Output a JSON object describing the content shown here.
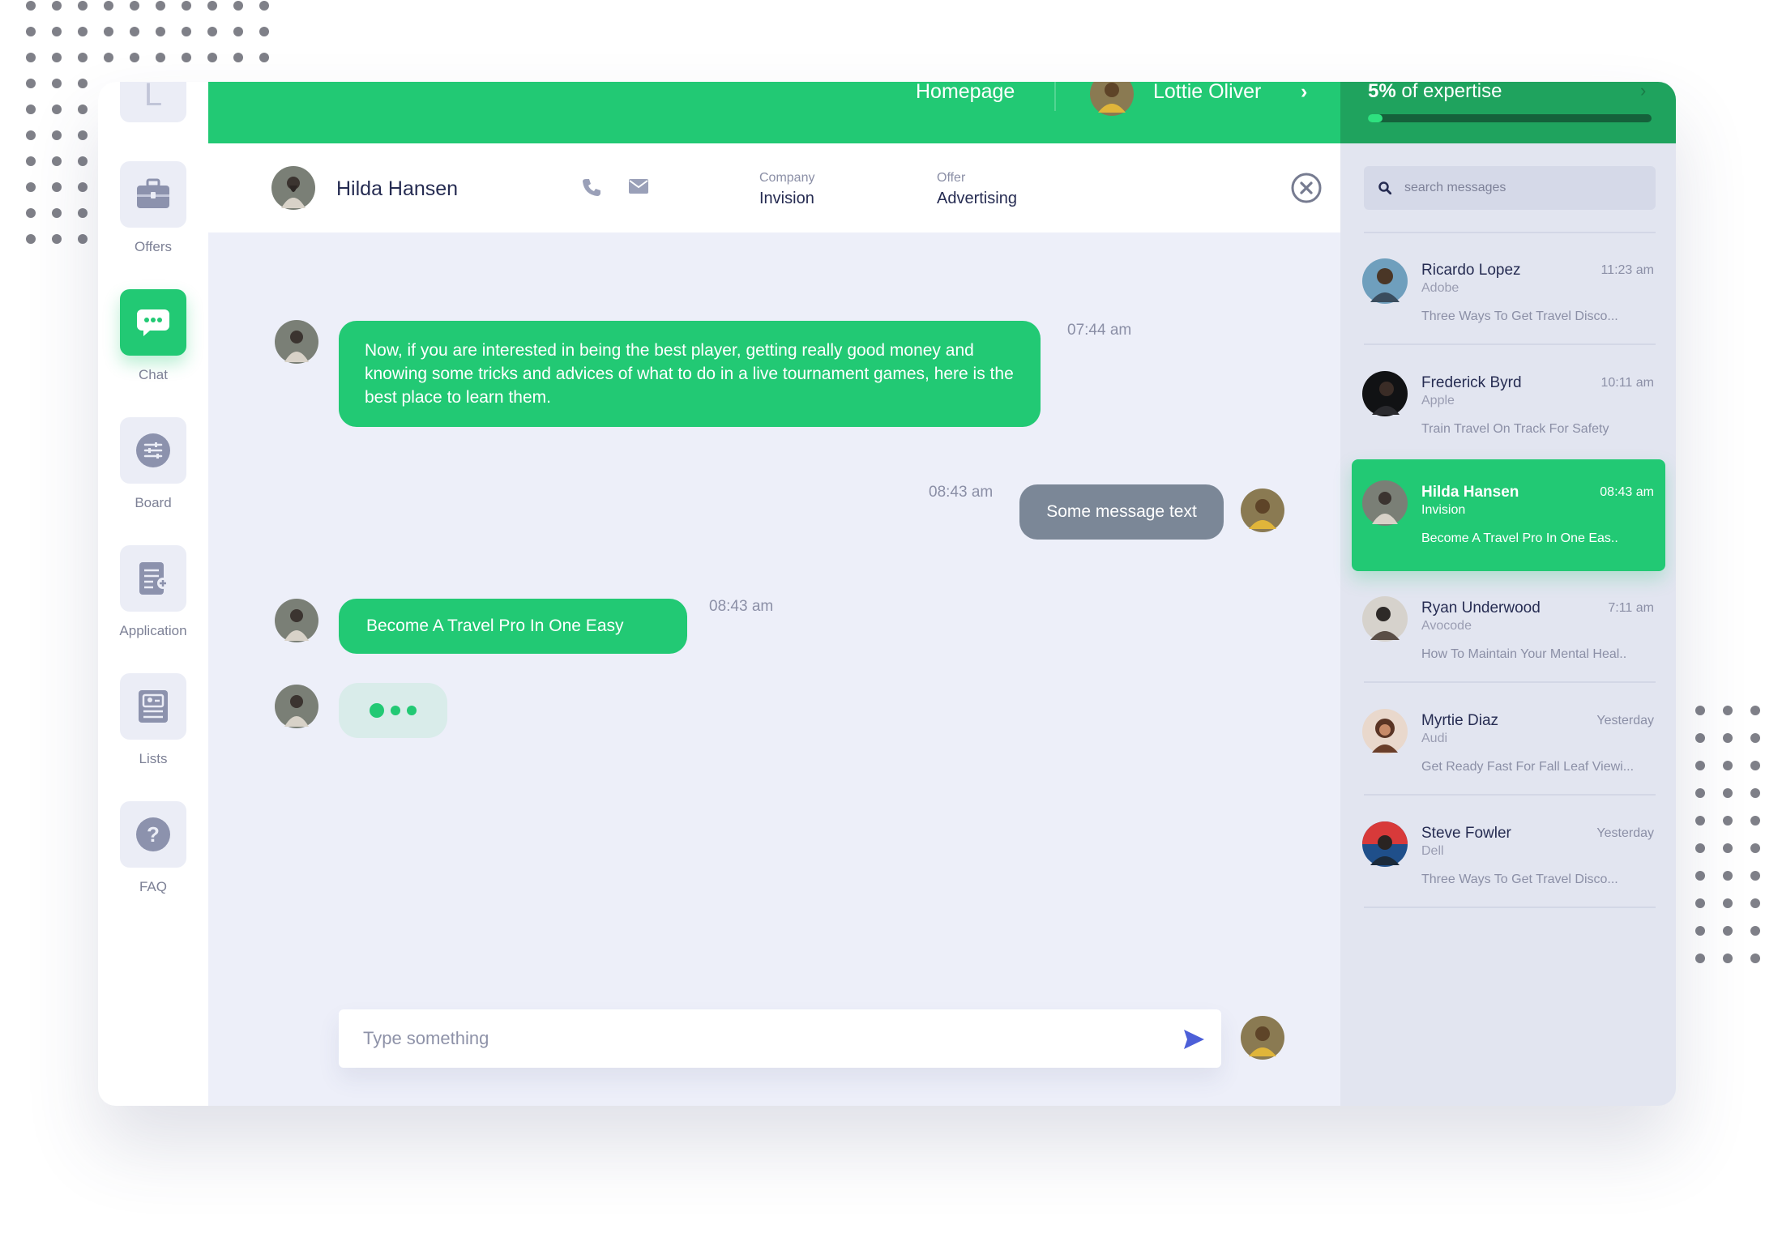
{
  "colors": {
    "accent": "#22c974",
    "accent_dark": "#1fa35e",
    "outgoing": "#7b8797",
    "ink": "#262c52",
    "muted": "#8b8fa6",
    "send": "#4c5fd8"
  },
  "nav": {
    "logo_letter": "L",
    "items": [
      {
        "label": "Offers",
        "icon": "briefcase-icon"
      },
      {
        "label": "Chat",
        "icon": "chat-bubble-icon",
        "active": true
      },
      {
        "label": "Board",
        "icon": "sliders-icon"
      },
      {
        "label": "Application",
        "icon": "document-add-icon"
      },
      {
        "label": "Lists",
        "icon": "id-card-icon"
      },
      {
        "label": "FAQ",
        "icon": "question-icon"
      }
    ]
  },
  "topbar": {
    "homepage": "Homepage",
    "user_name": "Lottie Oliver"
  },
  "expertise": {
    "value": "5%",
    "text": "of expertise",
    "fraction": 0.05
  },
  "chat_header": {
    "name": "Hilda Hansen",
    "company_label": "Company",
    "company": "Invision",
    "offer_label": "Offer",
    "offer": "Advertising"
  },
  "messages": [
    {
      "direction": "in",
      "text": "Now, if you are interested in being the best player, getting really good money and knowing some tricks and advices of what to do in a live tournament games, here is the best place to learn them.",
      "time": "07:44 am"
    },
    {
      "direction": "out",
      "text": "Some message text",
      "time": "08:43 am"
    },
    {
      "direction": "in",
      "text": "Become A Travel Pro In One Easy",
      "time": "08:43 am"
    }
  ],
  "composer": {
    "placeholder": "Type something"
  },
  "search": {
    "placeholder": "search messages"
  },
  "conversations": [
    {
      "name": "Ricardo Lopez",
      "company": "Adobe",
      "time": "11:23 am",
      "preview": "Three Ways To Get Travel Disco..."
    },
    {
      "name": "Frederick Byrd",
      "company": "Apple",
      "time": "10:11 am",
      "preview": "Train Travel On Track For Safety"
    },
    {
      "name": "Hilda Hansen",
      "company": "Invision",
      "time": "08:43 am",
      "preview": "Become A Travel Pro In One Eas..",
      "active": true
    },
    {
      "name": "Ryan Underwood",
      "company": "Avocode",
      "time": "7:11 am",
      "preview": "How To Maintain Your Mental Heal.."
    },
    {
      "name": "Myrtie Diaz",
      "company": "Audi",
      "time": "Yesterday",
      "preview": "Get Ready Fast For Fall Leaf Viewi..."
    },
    {
      "name": "Steve Fowler",
      "company": "Dell",
      "time": "Yesterday",
      "preview": "Three Ways To Get Travel Disco..."
    }
  ]
}
